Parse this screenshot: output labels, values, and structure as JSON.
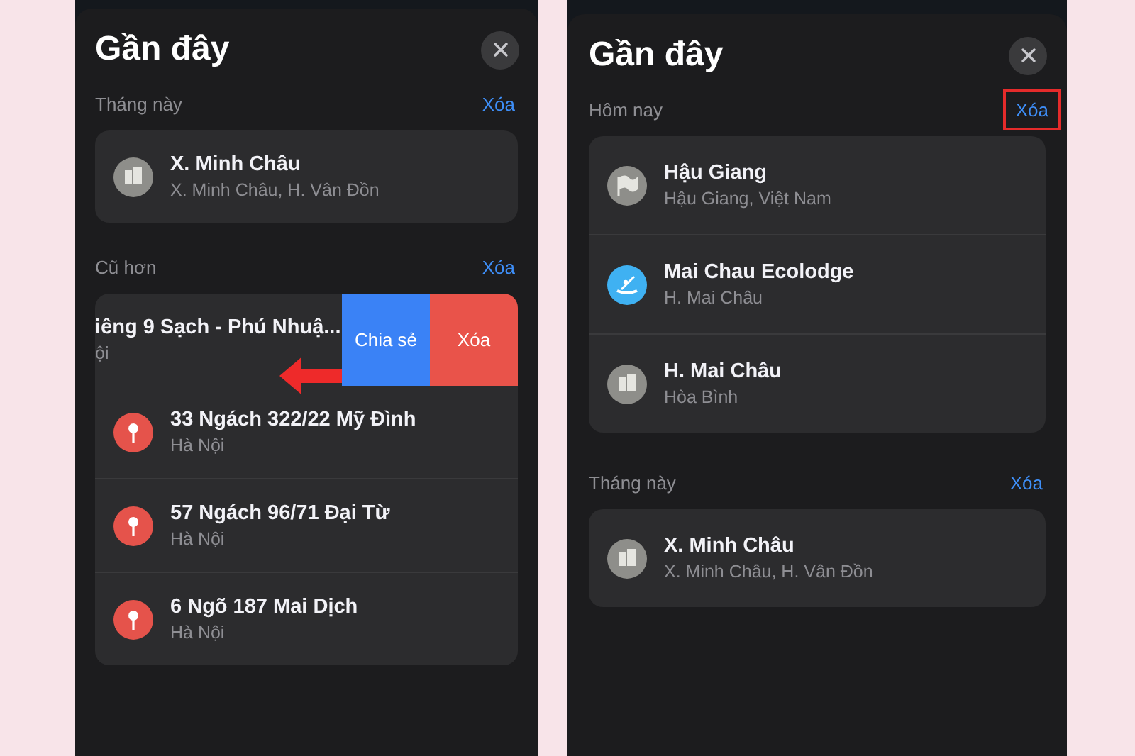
{
  "phones": [
    {
      "title": "Gần đây",
      "sections": [
        {
          "heading": "Tháng này",
          "clear_label": "Xóa",
          "highlighted": false,
          "items": [
            {
              "kind": "city",
              "name": "X. Minh Châu",
              "address": "X. Minh Châu, H. Vân Đồn"
            }
          ]
        },
        {
          "heading": "Cũ hơn",
          "clear_label": "Xóa",
          "highlighted": false,
          "items": [
            {
              "kind": "swiped",
              "name": "iêng 9 Sạch - Phú Nhuậ...",
              "address": "ội",
              "actions": [
                "Chia sẻ",
                "Xóa"
              ],
              "arrow": true
            },
            {
              "kind": "pin",
              "name": "33 Ngách 322/22 Mỹ Đình",
              "address": "Hà Nội"
            },
            {
              "kind": "pin",
              "name": "57 Ngách 96/71 Đại Từ",
              "address": "Hà Nội"
            },
            {
              "kind": "pin",
              "name": "6 Ngõ 187 Mai Dịch",
              "address": "Hà Nội"
            }
          ]
        }
      ]
    },
    {
      "title": "Gần đây",
      "sections": [
        {
          "heading": "Hôm nay",
          "clear_label": "Xóa",
          "highlighted": true,
          "items": [
            {
              "kind": "flag",
              "name": "Hậu Giang",
              "address": "Hậu Giang, Việt Nam"
            },
            {
              "kind": "kayak",
              "name": "Mai Chau Ecolodge",
              "address": "H. Mai Châu"
            },
            {
              "kind": "city",
              "name": "H. Mai Châu",
              "address": "Hòa Bình"
            }
          ]
        },
        {
          "heading": "Tháng này",
          "clear_label": "Xóa",
          "highlighted": false,
          "items": [
            {
              "kind": "city",
              "name": "X. Minh Châu",
              "address": "X. Minh Châu, H. Vân Đồn"
            }
          ]
        }
      ]
    }
  ]
}
